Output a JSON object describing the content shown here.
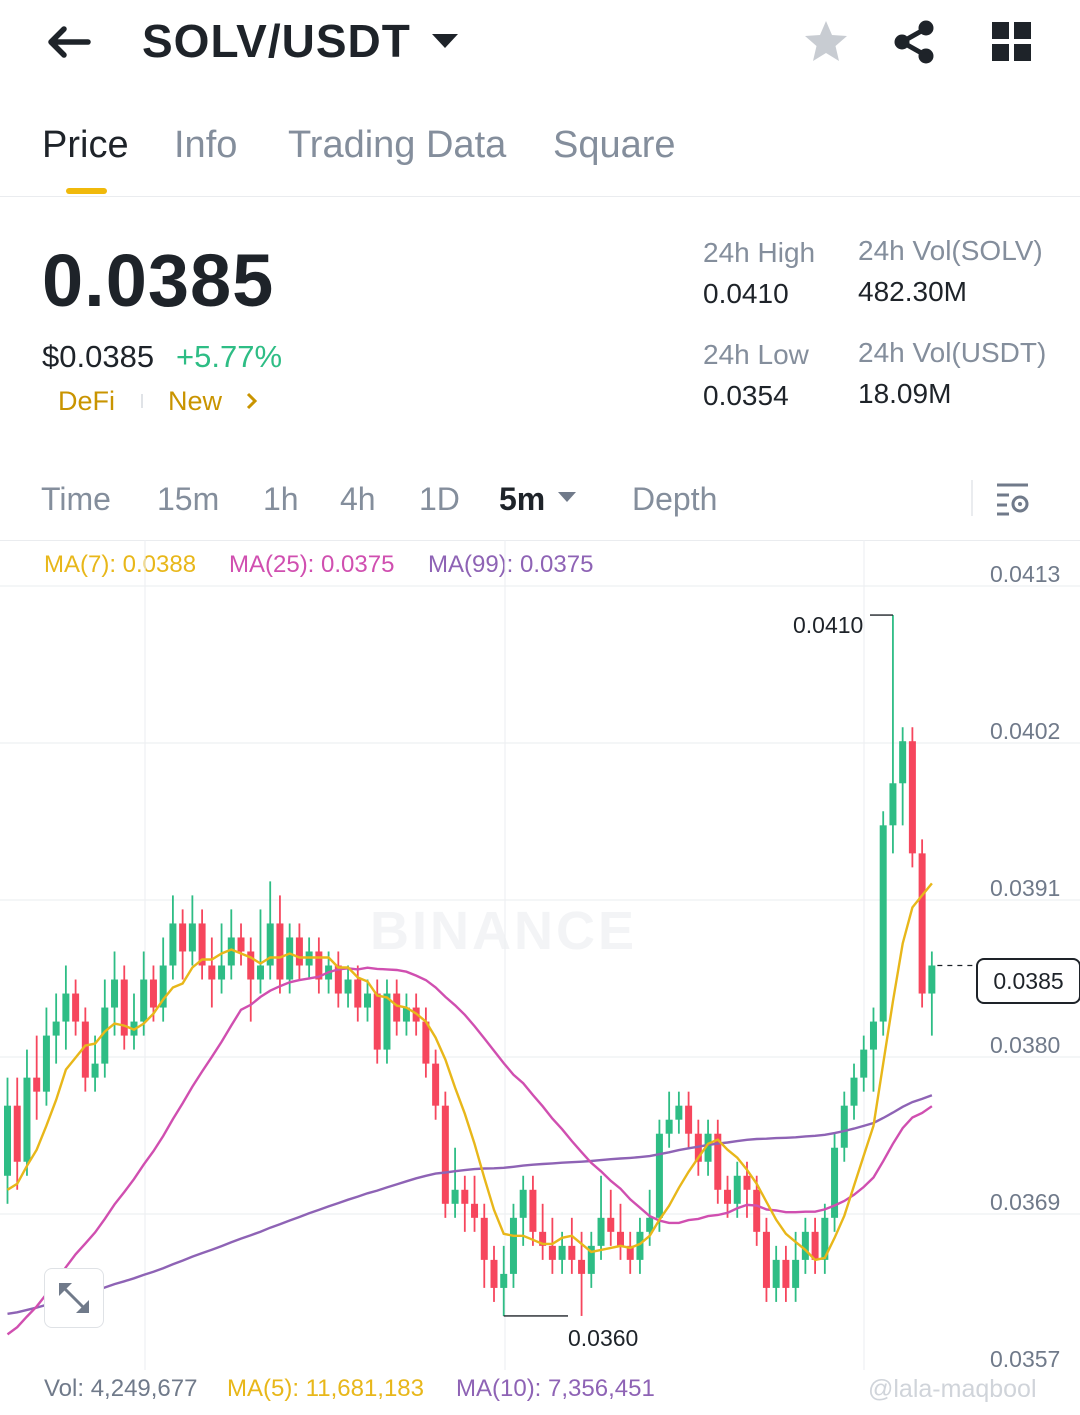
{
  "header": {
    "pair": "SOLV/USDT",
    "back_icon": "arrow-left-icon",
    "icons": [
      "star-icon",
      "share-icon",
      "grid-icon"
    ]
  },
  "tabs": [
    {
      "label": "Price",
      "active": true
    },
    {
      "label": "Info",
      "active": false
    },
    {
      "label": "Trading Data",
      "active": false
    },
    {
      "label": "Square",
      "active": false
    }
  ],
  "price": {
    "last": "0.0385",
    "usd": "$0.0385",
    "change": "+5.77%",
    "tags": [
      "DeFi",
      "New"
    ]
  },
  "stats": {
    "high_label": "24h High",
    "high": "0.0410",
    "low_label": "24h Low",
    "low": "0.0354",
    "vol_base_label": "24h Vol(SOLV)",
    "vol_base": "482.30M",
    "vol_quote_label": "24h Vol(USDT)",
    "vol_quote": "18.09M"
  },
  "intervals": [
    {
      "label": "Time"
    },
    {
      "label": "15m"
    },
    {
      "label": "1h"
    },
    {
      "label": "4h"
    },
    {
      "label": "1D"
    },
    {
      "label": "5m",
      "active": true
    },
    {
      "label": "Depth"
    }
  ],
  "legend": {
    "ma7": "MA(7): 0.0388",
    "ma25": "MA(25): 0.0375",
    "ma99": "MA(99): 0.0375"
  },
  "y_axis": [
    "0.0413",
    "0.0402",
    "0.0391",
    "0.0380",
    "0.0369",
    "0.0357"
  ],
  "chart_annotations": {
    "high_mark": "0.0410",
    "low_mark": "0.0360",
    "current": "0.0385"
  },
  "volume": {
    "vol": "Vol: 4,249,677",
    "ma5": "MA(5): 11,681,183",
    "ma10": "MA(10): 7,356,451"
  },
  "watermark": "BINANCE",
  "credit": "@lala-maqbool",
  "colors": {
    "up": "#2ebd85",
    "down": "#f6465d",
    "ma7": "#e8b71a",
    "ma25": "#d04fb0",
    "ma99": "#8e63b5",
    "accent": "#f0b90b"
  },
  "chart_data": {
    "type": "candlestick",
    "ylim": [
      0.0357,
      0.0413
    ],
    "candles": [
      {
        "o": 0.037,
        "c": 0.0375,
        "h": 0.0377,
        "l": 0.0368
      },
      {
        "o": 0.0375,
        "c": 0.0371,
        "h": 0.0377,
        "l": 0.0369
      },
      {
        "o": 0.0371,
        "c": 0.0377,
        "h": 0.0379,
        "l": 0.037
      },
      {
        "o": 0.0377,
        "c": 0.0376,
        "h": 0.038,
        "l": 0.0374
      },
      {
        "o": 0.0376,
        "c": 0.038,
        "h": 0.0382,
        "l": 0.0375
      },
      {
        "o": 0.038,
        "c": 0.0381,
        "h": 0.0383,
        "l": 0.0378
      },
      {
        "o": 0.0381,
        "c": 0.0383,
        "h": 0.0385,
        "l": 0.0379
      },
      {
        "o": 0.0383,
        "c": 0.0381,
        "h": 0.0384,
        "l": 0.038
      },
      {
        "o": 0.0381,
        "c": 0.0377,
        "h": 0.0382,
        "l": 0.0376
      },
      {
        "o": 0.0377,
        "c": 0.0378,
        "h": 0.038,
        "l": 0.0376
      },
      {
        "o": 0.0378,
        "c": 0.0382,
        "h": 0.0384,
        "l": 0.0377
      },
      {
        "o": 0.0382,
        "c": 0.0384,
        "h": 0.0386,
        "l": 0.038
      },
      {
        "o": 0.0384,
        "c": 0.038,
        "h": 0.0385,
        "l": 0.0379
      },
      {
        "o": 0.038,
        "c": 0.0381,
        "h": 0.0383,
        "l": 0.0379
      },
      {
        "o": 0.0381,
        "c": 0.0384,
        "h": 0.0386,
        "l": 0.038
      },
      {
        "o": 0.0384,
        "c": 0.0382,
        "h": 0.0385,
        "l": 0.0381
      },
      {
        "o": 0.0382,
        "c": 0.0385,
        "h": 0.0387,
        "l": 0.0381
      },
      {
        "o": 0.0385,
        "c": 0.0388,
        "h": 0.039,
        "l": 0.0384
      },
      {
        "o": 0.0388,
        "c": 0.0386,
        "h": 0.0389,
        "l": 0.0384
      },
      {
        "o": 0.0386,
        "c": 0.0388,
        "h": 0.039,
        "l": 0.0385
      },
      {
        "o": 0.0388,
        "c": 0.0385,
        "h": 0.0389,
        "l": 0.0384
      },
      {
        "o": 0.0385,
        "c": 0.0384,
        "h": 0.0387,
        "l": 0.0382
      },
      {
        "o": 0.0384,
        "c": 0.0385,
        "h": 0.0388,
        "l": 0.0383
      },
      {
        "o": 0.0385,
        "c": 0.0387,
        "h": 0.0389,
        "l": 0.0384
      },
      {
        "o": 0.0387,
        "c": 0.0386,
        "h": 0.0388,
        "l": 0.0385
      },
      {
        "o": 0.0386,
        "c": 0.0384,
        "h": 0.0387,
        "l": 0.0381
      },
      {
        "o": 0.0384,
        "c": 0.0385,
        "h": 0.0389,
        "l": 0.0383
      },
      {
        "o": 0.0385,
        "c": 0.0388,
        "h": 0.0391,
        "l": 0.0384
      },
      {
        "o": 0.0388,
        "c": 0.0384,
        "h": 0.039,
        "l": 0.0383
      },
      {
        "o": 0.0384,
        "c": 0.0387,
        "h": 0.0388,
        "l": 0.0383
      },
      {
        "o": 0.0387,
        "c": 0.0385,
        "h": 0.0388,
        "l": 0.0384
      },
      {
        "o": 0.0385,
        "c": 0.0386,
        "h": 0.0387,
        "l": 0.0384
      },
      {
        "o": 0.0386,
        "c": 0.0384,
        "h": 0.0387,
        "l": 0.0383
      },
      {
        "o": 0.0384,
        "c": 0.0385,
        "h": 0.0386,
        "l": 0.0383
      },
      {
        "o": 0.0385,
        "c": 0.0383,
        "h": 0.0386,
        "l": 0.0382
      },
      {
        "o": 0.0383,
        "c": 0.0384,
        "h": 0.0385,
        "l": 0.0382
      },
      {
        "o": 0.0384,
        "c": 0.0382,
        "h": 0.0385,
        "l": 0.0381
      },
      {
        "o": 0.0382,
        "c": 0.0383,
        "h": 0.0384,
        "l": 0.0381
      },
      {
        "o": 0.0383,
        "c": 0.0379,
        "h": 0.0384,
        "l": 0.0378
      },
      {
        "o": 0.0379,
        "c": 0.0383,
        "h": 0.0384,
        "l": 0.0378
      },
      {
        "o": 0.0383,
        "c": 0.0381,
        "h": 0.0384,
        "l": 0.038
      },
      {
        "o": 0.0381,
        "c": 0.0382,
        "h": 0.0383,
        "l": 0.038
      },
      {
        "o": 0.0382,
        "c": 0.0381,
        "h": 0.0383,
        "l": 0.038
      },
      {
        "o": 0.0381,
        "c": 0.0378,
        "h": 0.0382,
        "l": 0.0377
      },
      {
        "o": 0.0378,
        "c": 0.0375,
        "h": 0.0379,
        "l": 0.0374
      },
      {
        "o": 0.0375,
        "c": 0.0368,
        "h": 0.0376,
        "l": 0.0367
      },
      {
        "o": 0.0368,
        "c": 0.0369,
        "h": 0.0372,
        "l": 0.0367
      },
      {
        "o": 0.0369,
        "c": 0.0368,
        "h": 0.037,
        "l": 0.0366
      },
      {
        "o": 0.0368,
        "c": 0.0367,
        "h": 0.037,
        "l": 0.0366
      },
      {
        "o": 0.0367,
        "c": 0.0364,
        "h": 0.0368,
        "l": 0.0362
      },
      {
        "o": 0.0364,
        "c": 0.0362,
        "h": 0.0365,
        "l": 0.0361
      },
      {
        "o": 0.0362,
        "c": 0.0363,
        "h": 0.0365,
        "l": 0.036
      },
      {
        "o": 0.0363,
        "c": 0.0367,
        "h": 0.0368,
        "l": 0.0362
      },
      {
        "o": 0.0367,
        "c": 0.0369,
        "h": 0.037,
        "l": 0.0365
      },
      {
        "o": 0.0369,
        "c": 0.0366,
        "h": 0.037,
        "l": 0.0365
      },
      {
        "o": 0.0366,
        "c": 0.0365,
        "h": 0.0368,
        "l": 0.0364
      },
      {
        "o": 0.0365,
        "c": 0.0364,
        "h": 0.0367,
        "l": 0.0363
      },
      {
        "o": 0.0364,
        "c": 0.0365,
        "h": 0.0366,
        "l": 0.0363
      },
      {
        "o": 0.0365,
        "c": 0.0364,
        "h": 0.0367,
        "l": 0.0363
      },
      {
        "o": 0.0364,
        "c": 0.0363,
        "h": 0.0366,
        "l": 0.036
      },
      {
        "o": 0.0363,
        "c": 0.0365,
        "h": 0.0366,
        "l": 0.0362
      },
      {
        "o": 0.0365,
        "c": 0.0367,
        "h": 0.037,
        "l": 0.0364
      },
      {
        "o": 0.0367,
        "c": 0.0366,
        "h": 0.0369,
        "l": 0.0365
      },
      {
        "o": 0.0366,
        "c": 0.0365,
        "h": 0.0368,
        "l": 0.0364
      },
      {
        "o": 0.0365,
        "c": 0.0364,
        "h": 0.0366,
        "l": 0.0363
      },
      {
        "o": 0.0364,
        "c": 0.0366,
        "h": 0.0367,
        "l": 0.0363
      },
      {
        "o": 0.0366,
        "c": 0.0367,
        "h": 0.0369,
        "l": 0.0365
      },
      {
        "o": 0.0367,
        "c": 0.0373,
        "h": 0.0374,
        "l": 0.0366
      },
      {
        "o": 0.0373,
        "c": 0.0374,
        "h": 0.0376,
        "l": 0.0372
      },
      {
        "o": 0.0374,
        "c": 0.0375,
        "h": 0.0376,
        "l": 0.0373
      },
      {
        "o": 0.0375,
        "c": 0.0373,
        "h": 0.0376,
        "l": 0.0372
      },
      {
        "o": 0.0373,
        "c": 0.0371,
        "h": 0.0374,
        "l": 0.037
      },
      {
        "o": 0.0371,
        "c": 0.0373,
        "h": 0.0374,
        "l": 0.037
      },
      {
        "o": 0.0373,
        "c": 0.0369,
        "h": 0.0374,
        "l": 0.0368
      },
      {
        "o": 0.0369,
        "c": 0.0368,
        "h": 0.037,
        "l": 0.0367
      },
      {
        "o": 0.0368,
        "c": 0.037,
        "h": 0.0371,
        "l": 0.0367
      },
      {
        "o": 0.037,
        "c": 0.0369,
        "h": 0.0371,
        "l": 0.0367
      },
      {
        "o": 0.0369,
        "c": 0.0366,
        "h": 0.037,
        "l": 0.0365
      },
      {
        "o": 0.0366,
        "c": 0.0362,
        "h": 0.0367,
        "l": 0.0361
      },
      {
        "o": 0.0362,
        "c": 0.0364,
        "h": 0.0365,
        "l": 0.0361
      },
      {
        "o": 0.0364,
        "c": 0.0362,
        "h": 0.0365,
        "l": 0.0361
      },
      {
        "o": 0.0362,
        "c": 0.0364,
        "h": 0.0366,
        "l": 0.0361
      },
      {
        "o": 0.0364,
        "c": 0.0366,
        "h": 0.0367,
        "l": 0.0363
      },
      {
        "o": 0.0366,
        "c": 0.0364,
        "h": 0.0367,
        "l": 0.0363
      },
      {
        "o": 0.0364,
        "c": 0.0367,
        "h": 0.0368,
        "l": 0.0363
      },
      {
        "o": 0.0367,
        "c": 0.0372,
        "h": 0.0373,
        "l": 0.0366
      },
      {
        "o": 0.0372,
        "c": 0.0375,
        "h": 0.0376,
        "l": 0.0371
      },
      {
        "o": 0.0375,
        "c": 0.0377,
        "h": 0.0378,
        "l": 0.0374
      },
      {
        "o": 0.0377,
        "c": 0.0379,
        "h": 0.038,
        "l": 0.0376
      },
      {
        "o": 0.0379,
        "c": 0.0381,
        "h": 0.0382,
        "l": 0.0376
      },
      {
        "o": 0.0381,
        "c": 0.0395,
        "h": 0.0396,
        "l": 0.038
      },
      {
        "o": 0.0395,
        "c": 0.0398,
        "h": 0.041,
        "l": 0.0393
      },
      {
        "o": 0.0398,
        "c": 0.0401,
        "h": 0.0402,
        "l": 0.0395
      },
      {
        "o": 0.0401,
        "c": 0.0393,
        "h": 0.0402,
        "l": 0.0392
      },
      {
        "o": 0.0393,
        "c": 0.0383,
        "h": 0.0394,
        "l": 0.0382
      },
      {
        "o": 0.0383,
        "c": 0.0385,
        "h": 0.0386,
        "l": 0.038
      }
    ]
  }
}
